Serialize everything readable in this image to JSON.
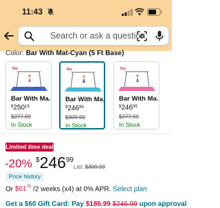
{
  "status_bar": {
    "time": "11:43"
  },
  "search": {
    "placeholder": "Search or ask a question"
  },
  "color": {
    "label": "Color:",
    "value": "Bar With Mat-Cyan (5 Ft Base)"
  },
  "variants": [
    {
      "name": "Bar With Ma...",
      "price_dollar": "$",
      "price_whole": "250",
      "price_cents": "19",
      "list_price": "$277.99",
      "stock": "In Stock",
      "mat_color": "#3e63c8",
      "selected": false
    },
    {
      "name": "Bar With Ma...",
      "price_dollar": "$",
      "price_whole": "246",
      "price_cents": "99",
      "list_price": "$309.99",
      "stock": "In Stock",
      "mat_color": "#48b9d6",
      "selected": true
    },
    {
      "name": "Bar With Ma...",
      "price_dollar": "$",
      "price_whole": "246",
      "price_cents": "99",
      "list_price": "$277.99",
      "stock": "In Stock",
      "mat_color": "#ec6fa6",
      "selected": false
    }
  ],
  "deal": {
    "badge": "Limited time deal",
    "discount": "-20%",
    "price_dollar": "$",
    "price_whole": "246",
    "price_cents": "99",
    "list_label": "List:",
    "list_price": "$309.99"
  },
  "price_history": "Price history",
  "installments": {
    "prefix": "Or",
    "amount_dollar": "$61",
    "amount_cents": "75",
    "terms": "/2 weeks (x4) at 0% APR.",
    "link": "Select plan"
  },
  "gift_card": {
    "text": "Get a $60 Gift Card: Pay",
    "new_price": "$186.99",
    "old_price": "$246.99",
    "suffix": "upon approval"
  },
  "colors": {
    "header_bg": "#fad59b",
    "teal": "#007185",
    "deal_red": "#cc0c39",
    "in_stock": "#007600"
  }
}
